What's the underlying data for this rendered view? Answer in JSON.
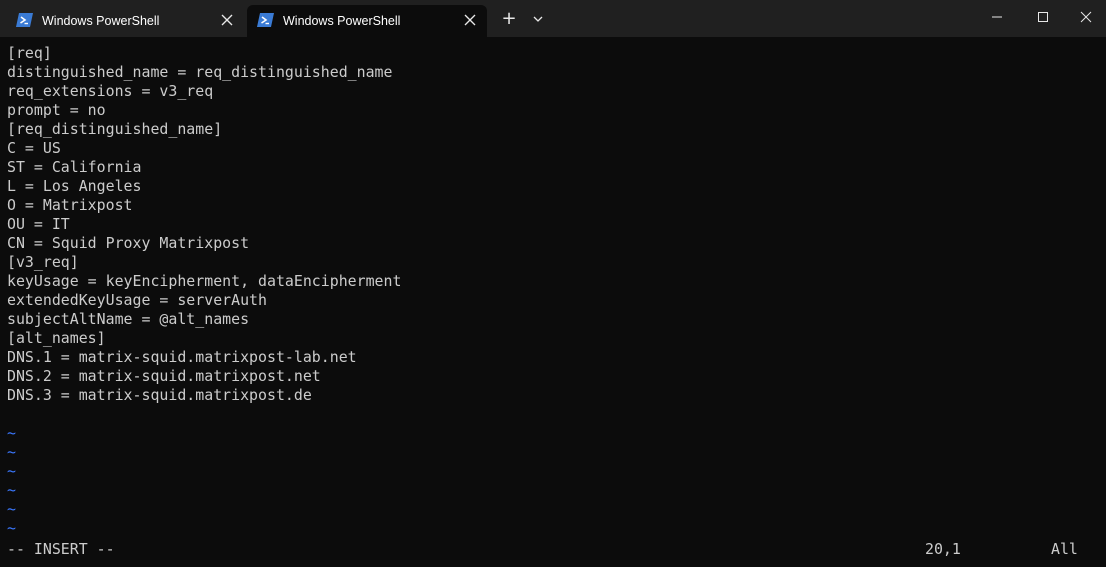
{
  "tabs": [
    {
      "title": "Windows PowerShell",
      "active": false
    },
    {
      "title": "Windows PowerShell",
      "active": true
    }
  ],
  "tabbar": {
    "new_tab_label": "+"
  },
  "editor": {
    "lines": [
      "[req]",
      "distinguished_name = req_distinguished_name",
      "req_extensions = v3_req",
      "prompt = no",
      "[req_distinguished_name]",
      "C = US",
      "ST = California",
      "L = Los Angeles",
      "O = Matrixpost",
      "OU = IT",
      "CN = Squid Proxy Matrixpost",
      "[v3_req]",
      "keyUsage = keyEncipherment, dataEncipherment",
      "extendedKeyUsage = serverAuth",
      "subjectAltName = @alt_names",
      "[alt_names]",
      "DNS.1 = matrix-squid.matrixpost-lab.net",
      "DNS.2 = matrix-squid.matrixpost.net",
      "DNS.3 = matrix-squid.matrixpost.de",
      ""
    ],
    "tildes": [
      "~",
      "~",
      "~",
      "~",
      "~",
      "~"
    ]
  },
  "status": {
    "mode": "-- INSERT --",
    "cursor": "20,1",
    "scroll": "All"
  },
  "colors": {
    "background": "#0c0c0c",
    "titlebar": "#202020",
    "text": "#cccccc",
    "tilde": "#3b78ff",
    "powershell_icon": "#3a7bd5"
  }
}
